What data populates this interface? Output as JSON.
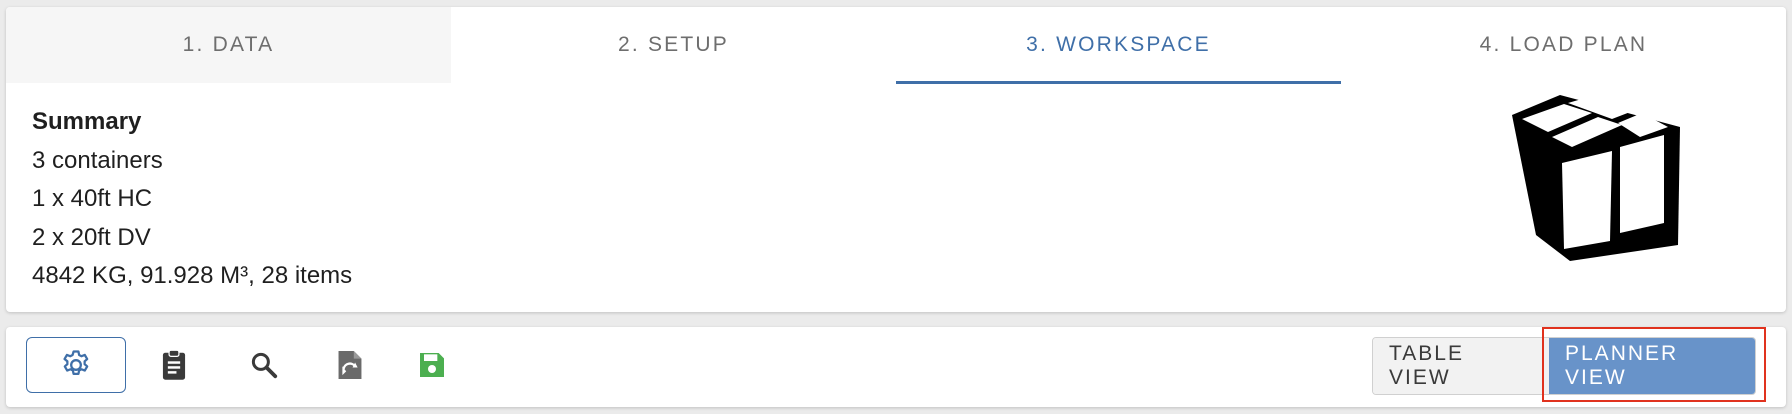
{
  "tabs": [
    {
      "label": "1. DATA",
      "active": false
    },
    {
      "label": "2. SETUP",
      "active": false
    },
    {
      "label": "3. WORKSPACE",
      "active": true
    },
    {
      "label": "4. LOAD PLAN",
      "active": false
    }
  ],
  "summary": {
    "title": "Summary",
    "lines": [
      "3 containers",
      "1 x 40ft HC",
      "2 x 20ft DV",
      "4842 KG, 91.928 M³, 28 items"
    ]
  },
  "toolbar": {
    "icons": [
      "gear-icon",
      "clipboard-icon",
      "search-icon",
      "file-import-icon",
      "save-icon"
    ],
    "table_view_label": "TABLE VIEW",
    "planner_view_label": "PLANNER VIEW"
  },
  "colors": {
    "accent": "#3f6fa8",
    "planner_button": "#6893c9",
    "save_icon": "#4caf50",
    "highlight": "#e0321e"
  }
}
